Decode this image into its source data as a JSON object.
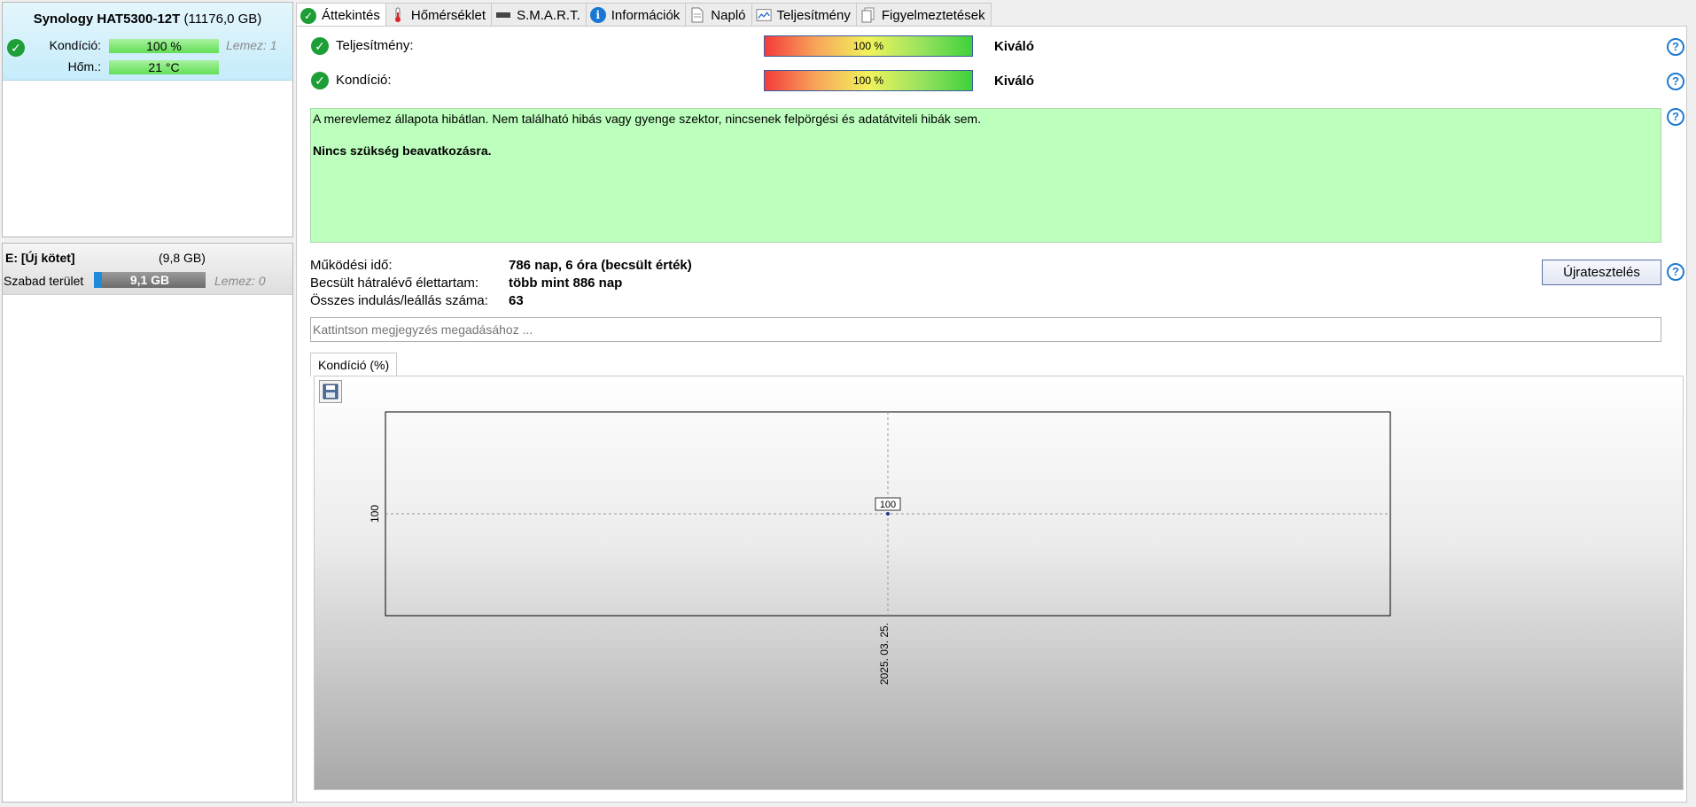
{
  "disk": {
    "name": "Synology HAT5300-12T",
    "size": "(11176,0 GB)",
    "health_label": "Kondíció:",
    "health_value": "100 %",
    "temp_label": "Hőm.:",
    "temp_value": "21 °C",
    "lemez": "Lemez: 1"
  },
  "volume": {
    "name": "E: [Új kötet]",
    "size": "(9,8 GB)",
    "free_label": "Szabad terület",
    "free_value": "9,1 GB",
    "free_fraction": 0.07,
    "lemez": "Lemez: 0"
  },
  "tabs": [
    {
      "label": "Áttekintés",
      "icon": "check-icon"
    },
    {
      "label": "Hőmérséklet",
      "icon": "thermometer-icon"
    },
    {
      "label": "S.M.A.R.T.",
      "icon": "drive-icon"
    },
    {
      "label": "Információk",
      "icon": "info-icon"
    },
    {
      "label": "Napló",
      "icon": "document-icon"
    },
    {
      "label": "Teljesítmény",
      "icon": "performance-chart-icon"
    },
    {
      "label": "Figyelmeztetések",
      "icon": "pages-icon"
    }
  ],
  "overview": {
    "performance_label": "Teljesítmény:",
    "performance_value": "100 %",
    "performance_rating": "Kiváló",
    "health_label": "Kondíció:",
    "health_value": "100 %",
    "health_rating": "Kiváló",
    "status_text": "A merevlemez állapota hibátlan. Nem található hibás vagy gyenge szektor, nincsenek felpörgési és adatátviteli hibák sem.",
    "status_action": "Nincs szükség beavatkozásra.",
    "uptime_label": "Működési idő:",
    "uptime_value": "786 nap, 6 óra (becsült érték)",
    "lifetime_label": "Becsült hátralévő élettartam:",
    "lifetime_value": "több mint 886 nap",
    "startstop_label": "Összes indulás/leállás száma:",
    "startstop_value": "63",
    "retest_label": "Újratesztelés",
    "note_placeholder": "Kattintson megjegyzés megadásához ...",
    "help": "?"
  },
  "chart_tab": "Kondíció  (%)",
  "chart_data": {
    "type": "scatter",
    "x": [
      "2025. 03. 25."
    ],
    "y": [
      100
    ],
    "data_labels": [
      "100"
    ],
    "y_tick_labels": [
      "100"
    ],
    "x_tick_labels": [
      "2025. 03. 25."
    ],
    "grid": true
  },
  "colors": {
    "selected_bg": "#c6ecfb",
    "status_bg": "#bdffbd",
    "check": "#1e9e36",
    "help": "#1f7bd1"
  }
}
